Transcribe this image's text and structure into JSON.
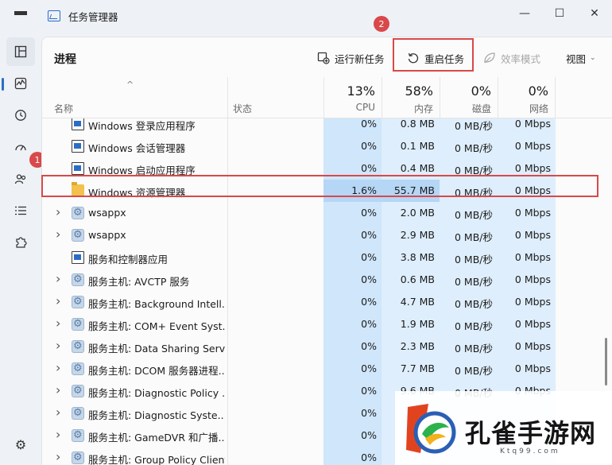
{
  "app": {
    "title": "任务管理器"
  },
  "window_controls": {
    "minimize": "—",
    "maximize": "☐",
    "close": "✕"
  },
  "toolbar": {
    "page_title": "进程",
    "run_new_task": "运行新任务",
    "restart_task": "重启任务",
    "efficiency_mode": "效率模式",
    "view": "视图"
  },
  "columns": {
    "name": "名称",
    "status": "状态",
    "cpu": {
      "pct": "13%",
      "label": "CPU"
    },
    "memory": {
      "pct": "58%",
      "label": "内存"
    },
    "disk": {
      "pct": "0%",
      "label": "磁盘"
    },
    "network": {
      "pct": "0%",
      "label": "网络"
    }
  },
  "rows": [
    {
      "name": "Windows 登录应用程序",
      "icon": "window-icon",
      "expandable": false,
      "cpu": "0%",
      "mem": "0.8 MB",
      "disk": "0 MB/秒",
      "net": "0 Mbps"
    },
    {
      "name": "Windows 会话管理器",
      "icon": "window-icon",
      "expandable": false,
      "cpu": "0%",
      "mem": "0.1 MB",
      "disk": "0 MB/秒",
      "net": "0 Mbps"
    },
    {
      "name": "Windows 启动应用程序",
      "icon": "window-icon",
      "expandable": false,
      "cpu": "0%",
      "mem": "0.4 MB",
      "disk": "0 MB/秒",
      "net": "0 Mbps"
    },
    {
      "name": "Windows 资源管理器",
      "icon": "folder-icon",
      "expandable": false,
      "cpu": "1.6%",
      "mem": "55.7 MB",
      "disk": "0 MB/秒",
      "net": "0 Mbps",
      "highlight": true
    },
    {
      "name": "wsappx",
      "icon": "gear-icon",
      "expandable": true,
      "cpu": "0%",
      "mem": "2.0 MB",
      "disk": "0 MB/秒",
      "net": "0 Mbps"
    },
    {
      "name": "wsappx",
      "icon": "gear-icon",
      "expandable": true,
      "cpu": "0%",
      "mem": "2.9 MB",
      "disk": "0 MB/秒",
      "net": "0 Mbps"
    },
    {
      "name": "服务和控制器应用",
      "icon": "window-icon",
      "expandable": false,
      "cpu": "0%",
      "mem": "3.8 MB",
      "disk": "0 MB/秒",
      "net": "0 Mbps"
    },
    {
      "name": "服务主机: AVCTP 服务",
      "icon": "gear-icon",
      "expandable": true,
      "cpu": "0%",
      "mem": "0.6 MB",
      "disk": "0 MB/秒",
      "net": "0 Mbps"
    },
    {
      "name": "服务主机: Background Intell...",
      "icon": "gear-icon",
      "expandable": true,
      "cpu": "0%",
      "mem": "4.7 MB",
      "disk": "0 MB/秒",
      "net": "0 Mbps"
    },
    {
      "name": "服务主机: COM+ Event Syst...",
      "icon": "gear-icon",
      "expandable": true,
      "cpu": "0%",
      "mem": "1.9 MB",
      "disk": "0 MB/秒",
      "net": "0 Mbps"
    },
    {
      "name": "服务主机: Data Sharing Serv...",
      "icon": "gear-icon",
      "expandable": true,
      "cpu": "0%",
      "mem": "2.3 MB",
      "disk": "0 MB/秒",
      "net": "0 Mbps"
    },
    {
      "name": "服务主机: DCOM 服务器进程...",
      "icon": "gear-icon",
      "expandable": true,
      "cpu": "0%",
      "mem": "7.7 MB",
      "disk": "0 MB/秒",
      "net": "0 Mbps"
    },
    {
      "name": "服务主机: Diagnostic Policy ...",
      "icon": "gear-icon",
      "expandable": true,
      "cpu": "0%",
      "mem": "9.6 MB",
      "disk": "0 MB/秒",
      "net": "0 Mbps"
    },
    {
      "name": "服务主机: Diagnostic Syste...",
      "icon": "gear-icon",
      "expandable": true,
      "cpu": "0%",
      "mem": "",
      "disk": "",
      "net": ""
    },
    {
      "name": "服务主机: GameDVR 和广播...",
      "icon": "gear-icon",
      "expandable": true,
      "cpu": "0%",
      "mem": "",
      "disk": "",
      "net": ""
    },
    {
      "name": "服务主机: Group Policy Client",
      "icon": "gear-icon",
      "expandable": true,
      "cpu": "0%",
      "mem": "",
      "disk": "",
      "net": ""
    }
  ],
  "annotations": {
    "badge1": "1",
    "badge2": "2"
  },
  "watermark": {
    "text": "孔雀手游网",
    "sub": "Ktq99.com"
  },
  "colors": {
    "accent": "#2b6dc6",
    "annotation_red": "#d9484a",
    "cpu_col": "#cfe6fb",
    "cpu_col_hl": "#b5d6f5"
  }
}
